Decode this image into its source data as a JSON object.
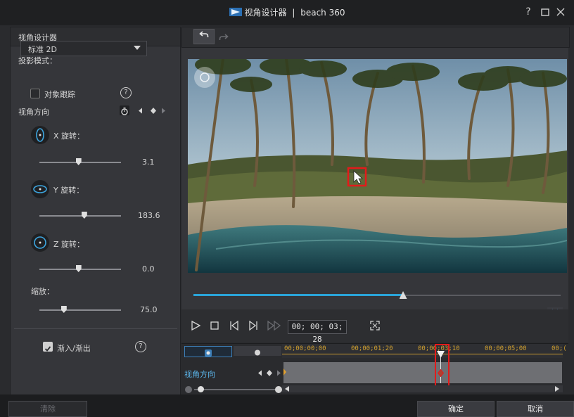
{
  "window": {
    "title": "视角设计器",
    "separator": "|",
    "project": "beach 360",
    "help_icon": "question-mark-icon",
    "maximize_icon": "maximize-icon",
    "close_icon": "close-icon"
  },
  "left_panel": {
    "header": "视角设计器",
    "projection_label": "投影模式：",
    "projection_value": "标准 2D",
    "track_object_label": "对象跟踪",
    "view_direction_label": "视角方向",
    "x_rotation_label": "X 旋转：",
    "x_rotation_value": "3.1",
    "x_rotation_level": 0.48,
    "y_rotation_label": "Y 旋转：",
    "y_rotation_value": "183.6",
    "y_rotation_level": 0.55,
    "z_rotation_label": "Z 旋转：",
    "z_rotation_value": "0.0",
    "z_rotation_level": 0.48,
    "zoom_label": "缩放：",
    "zoom_value": "75.0",
    "zoom_level": 0.3,
    "fade_label": "渐入/渐出",
    "fade_checked": true,
    "clear_button": "清除"
  },
  "player": {
    "timecode": "00; 00; 03; 28",
    "progress": 0.57
  },
  "timeline": {
    "track_label": "视角方向",
    "ruler_labels": [
      "00;00;00;00",
      "00;00;01;20",
      "00;00;03;10",
      "00;00;05;00",
      "00;("
    ]
  },
  "footer": {
    "ok_button": "确定",
    "cancel_button": "取消"
  },
  "colors": {
    "accent": "#2aa4d8",
    "highlight": "#e21b1b",
    "keyframe": "#e0a030"
  }
}
